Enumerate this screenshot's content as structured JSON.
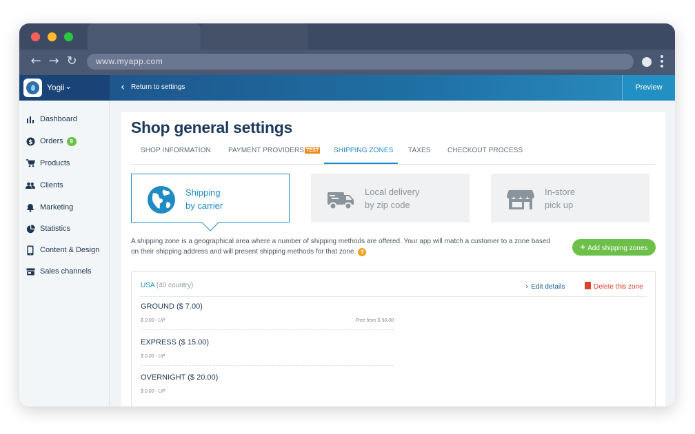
{
  "browser": {
    "url": "www.myapp.com"
  },
  "header": {
    "brand_name": "Yogii",
    "back_label": "Return to settings",
    "preview_label": "Preview"
  },
  "sidebar": {
    "items": [
      {
        "label": "Dashboard",
        "icon": "bar-chart-icon"
      },
      {
        "label": "Orders",
        "icon": "dollar-icon",
        "badge": "9"
      },
      {
        "label": "Products",
        "icon": "cart-icon"
      },
      {
        "label": "Clients",
        "icon": "people-icon"
      },
      {
        "label": "Marketing",
        "icon": "bell-icon"
      },
      {
        "label": "Statistics",
        "icon": "pie-chart-icon"
      },
      {
        "label": "Content & Design",
        "icon": "phone-icon"
      },
      {
        "label": "Sales channels",
        "icon": "store-icon"
      }
    ]
  },
  "main": {
    "title": "Shop general settings",
    "tabs": [
      {
        "label": "SHOP INFORMATION"
      },
      {
        "label": "PAYMENT PROVIDERS",
        "tag": "TEST"
      },
      {
        "label": "SHIPPING ZONES",
        "active": true
      },
      {
        "label": "TAXES"
      },
      {
        "label": "CHECKOUT PROCESS"
      }
    ],
    "methods": [
      {
        "line1": "Shipping",
        "line2": "by carrier",
        "icon": "globe-icon",
        "active": true
      },
      {
        "line1": "Local delivery",
        "line2": "by zip code",
        "icon": "truck-icon"
      },
      {
        "line1": "In-store",
        "line2": "pick up",
        "icon": "store-icon"
      }
    ],
    "description": "A shipping zone is a geographical area where a number of shipping methods are offered. Your app will match a customer to a zone based on their shipping address and will present shipping methods for that zone.",
    "add_button_label": "Add shipping zones",
    "zone": {
      "country": "USA",
      "country_count": "(40 country)",
      "edit_label": "Edit details",
      "delete_label": "Delete this zone",
      "rates": [
        {
          "name": "GROUND ($ 7.00)",
          "range": "$ 0.00 - UP",
          "note": "Free from $ 50.00"
        },
        {
          "name": "EXPRESS ($ 15.00)",
          "range": "$ 0.00 - UP",
          "note": ""
        },
        {
          "name": "OVERNIGHT ($ 20.00)",
          "range": "$ 0.00 - UP",
          "note": ""
        }
      ]
    }
  },
  "colors": {
    "accent": "#1f8bc4",
    "primary_dark": "#1d3a5c",
    "success": "#6cc04a",
    "danger": "#d9432f",
    "warning": "#f08a1e"
  }
}
